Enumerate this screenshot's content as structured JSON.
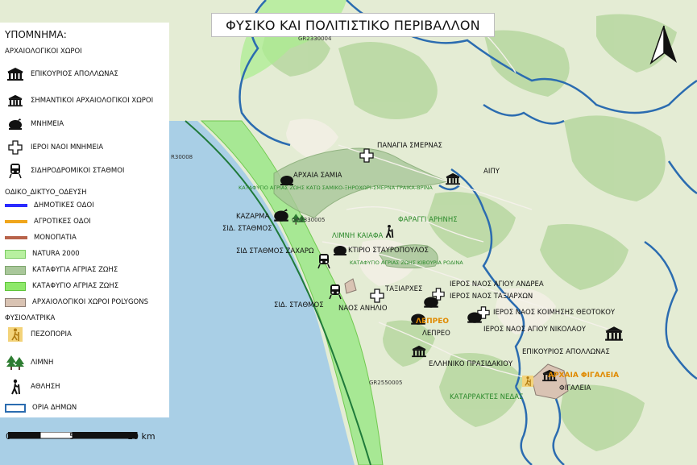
{
  "title": "ΦΥΣΙΚΟ ΚΑΙ ΠΟΛΙΤΙΣΤΙΚΟ ΠΕΡΙΒΑΛΛΟΝ",
  "legend": {
    "title": "ΥΠΟΜΝΗΜΑ:",
    "archaeo_heading": "ΑΡΧΑΙΟΛΟΓΙΚΟΙ ΧΩΡΟΙ",
    "archaeo_items": [
      {
        "label": "ΕΠΙΚΟΥΡΙΟΣ ΑΠΟΛΛΩΝΑΣ",
        "icon": "temple-large-icon"
      },
      {
        "label": "ΣΗΜΑΝΤΙΚΟΙ ΑΡΧΑΙΟΛΟΓΙΚΟΙ ΧΩΡΟΙ",
        "icon": "temple-icon"
      },
      {
        "label": "ΜΝΗΜΕΙΑ",
        "icon": "monument-icon"
      },
      {
        "label": "ΙΕΡΟΙ ΝΑΟΙ ΜΝΗΜΕΙΑ",
        "icon": "cross-icon"
      },
      {
        "label": "ΣΙΔΗΡΟΔΡΟΜΙΚΟΙ ΣΤΑΘΜΟΙ",
        "icon": "train-icon"
      }
    ],
    "road_heading": "ΟΔΙΚΟ_ΔΙΚΤΥΟ_ΟΔΕΥΣΗ",
    "road_items": [
      {
        "label": "ΔΗΜΟΤΙΚΕΣ ΟΔΟΙ",
        "color": "#2b2bff"
      },
      {
        "label": "ΑΓΡΟΤΙΚΕΣ ΟΔΟΙ",
        "color": "#f0a61c"
      },
      {
        "label": "ΜΟΝΟΠΑΤΙΑ",
        "color": "#b8634a"
      }
    ],
    "area_items": [
      {
        "label": "NATURA 2000",
        "fill": "#b8f0a0",
        "stroke": "#7ccc64"
      },
      {
        "label": "ΚΑΤΑΦΥΓΙΑ ΑΓΡΙΑΣ ΖΩΗΣ",
        "fill": "#a9c79a",
        "stroke": "#7ea66e"
      },
      {
        "label": "ΚΑΤΑΦΥΓΙΟ ΑΓΡΙΑΣ ΖΩΗΣ",
        "fill": "#8ee86a",
        "stroke": "#5ec43a"
      },
      {
        "label": "ΑΡΧΑΙΟΛΟΓΙΚΟΙ ΧΩΡΟΙ POLYGONS",
        "fill": "#d9c3b3",
        "stroke": "#8a7a70"
      }
    ],
    "nature_heading": "ΦΥΣΙΟΛΑΤΡΙΚΑ",
    "nature_items": [
      {
        "label": "ΠΕΖΟΠΟΡΙΑ",
        "icon": "hiking-icon"
      },
      {
        "label": "ΛΙΜΝΗ",
        "icon": "tree-icon"
      },
      {
        "label": "ΑΘΛΗΣΗ",
        "icon": "walker-icon"
      }
    ],
    "boundary_item": {
      "label": "ΟΡΙΑ ΔΗΜΩΝ",
      "color": "#2b6cb0"
    }
  },
  "scale": {
    "labels": [
      "0",
      "5",
      "10 km"
    ]
  },
  "map_labels": {
    "gr_top": "GR2330004",
    "gr_left": "R30008",
    "gr_mid": "GR2330005",
    "gr_bottom": "GR2550005",
    "panagia": "ΠΑΝΑΓΙΑ ΣΜΕΡΝΑΣ",
    "samia": "ΑΡΧΑΙΑ ΣΑΜΙΑ",
    "aipy": "ΑΙΠΥ",
    "katafygio_samiko": "ΚΑΤΑΦΥΓΙΟ ΑΓΡΙΑΣ ΖΩΗΣ ΚΑΤΩ ΣΑΜΙΚΟ-ΞΗΡΟΧΩΡΙ-ΣΜΕΡΝΑ ΓΡΑΙΚΑ-ΒΡΙΝΑ",
    "kazarma": "ΚΑΖΑΡΜΑ",
    "sid_stathmos_1": "ΣΙΔ. ΣΤΑΘΜΟΣ",
    "faraggi": "ΦΑΡΑΓΓΙ ΑΡΗΝΗΣ",
    "limni": "ΛΙΜΝΗ ΚΑΙΑΦΑ",
    "ktirio": "ΚΤΙΡΙΟ ΣΤΑΥΡΟΠΟΥΛΟΣ",
    "katafygio_kiv": "ΚΑΤΑΦΥΓΙΟ ΑΓΡΙΑΣ ΖΩΗΣ ΚΙΒΟΥΡΙΑ ΡΟΔΙΝΑ",
    "sid_zacharo": "ΣΙΔ ΣΤΑΘΜΟΣ ΖΑΧΑΡΩ",
    "taxiarches": "ΤΑΞΙΑΡΧΕΣ",
    "ieros_andrea": "ΙΕΡΟΣ ΝΑΟΣ ΑΓΙΟΥ ΑΝΔΡΕΑ",
    "ieros_taxiarxon": "ΙΕΡΟΣ ΝΑΟΣ ΤΑΞΙΑΡΧΩΝ",
    "sid_stathmos_2": "ΣΙΔ. ΣΤΑΘΜΟΣ",
    "naos_anilio": "ΝΑΟΣ ΑΝΗΛΙΟ",
    "ieros_koimisis": "ΙΕΡΟΣ ΝΑΟΣ ΚΟΙΜΗΣΗΣ ΘΕΟΤΟΚΟΥ",
    "lepreo_orange": "ΛΕΠΡΕΟ",
    "ieros_nikolaou": "ΙΕΡΟΣ ΝΑΟΣ ΑΓΙΟΥ ΝΙΚΟΛΑΟΥ",
    "lepreo": "ΛΕΠΡΕΟ",
    "epikourios": "ΕΠΙΚΟΥΡΙΟΣ ΑΠΟΛΛΩΝΑΣ",
    "praisdakiou": "ΕΛΛΗΝΙΚΟ ΠΡΑΣΙΔΑΚΙΟΥ",
    "archaia_figaleia": "ΑΡΧΑΙΑ ΦΙΓΑΛΕΙΑ",
    "figaleia": "ΦΙΓΑΛΕΙΑ",
    "katarraktes": "ΚΑΤΑΡΡΑΚΤΕΣ ΝΕΔΑΣ"
  }
}
